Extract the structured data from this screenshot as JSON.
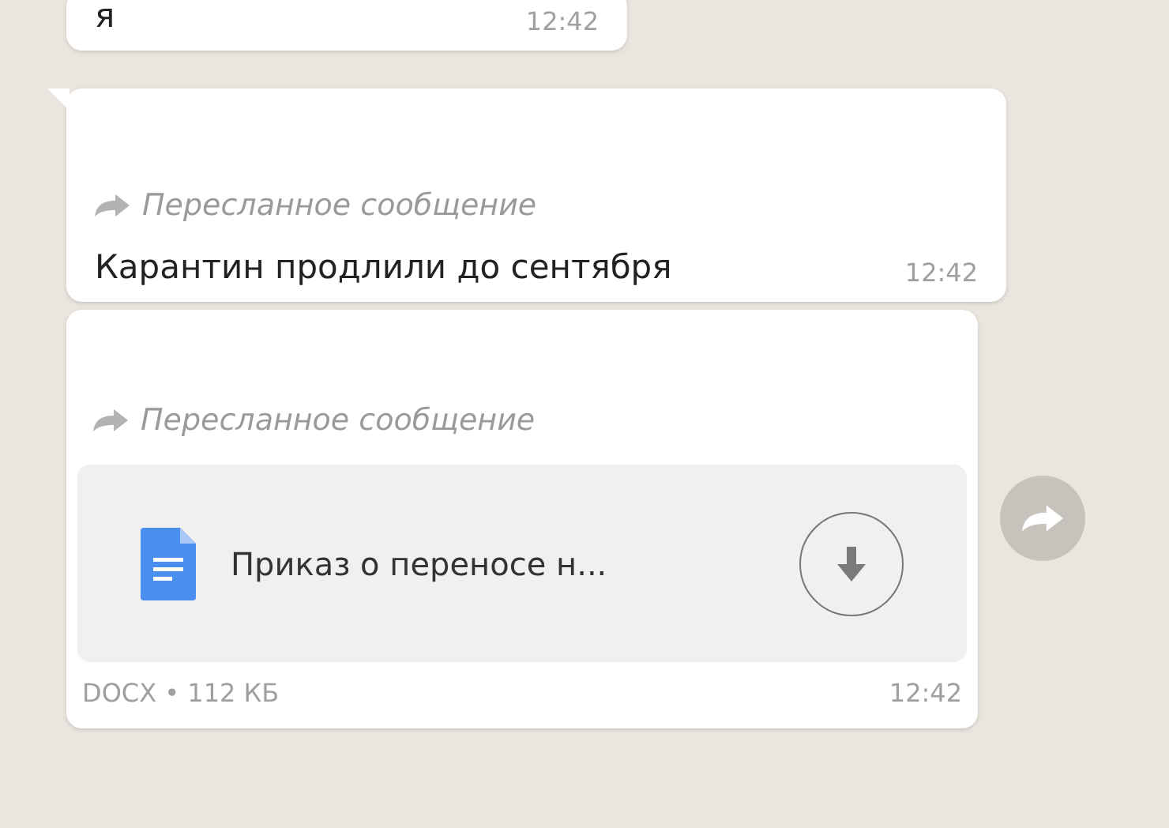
{
  "messages": [
    {
      "kind": "text",
      "tail": false,
      "text": "я",
      "time": "12:42"
    },
    {
      "kind": "text",
      "tail": true,
      "forwarded_label": "Пересланное сообщение",
      "text": "Карантин продлили до сентября",
      "time": "12:42"
    },
    {
      "kind": "document",
      "tail": false,
      "forwarded_label": "Пересланное сообщение",
      "file_name": "Приказ о переносе н...",
      "file_info": "DOCX • 112 КБ",
      "time": "12:42"
    }
  ]
}
